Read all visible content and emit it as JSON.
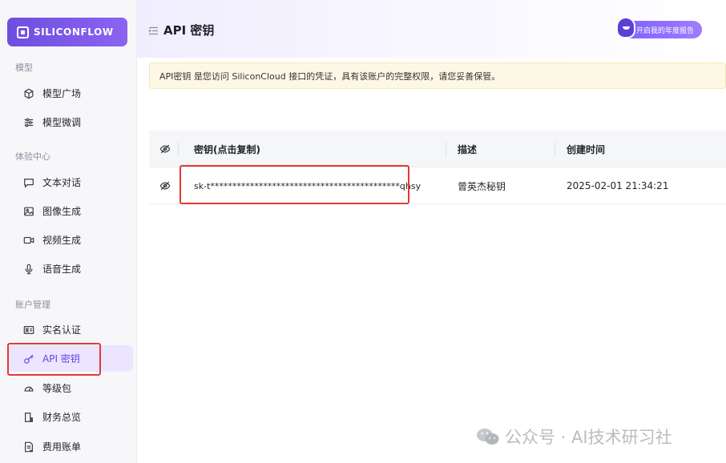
{
  "app": {
    "logo_text": "SILICONFLOW"
  },
  "sidebar": {
    "sections": [
      {
        "label": "模型",
        "items": [
          {
            "label": "模型广场",
            "icon": "cube-icon"
          },
          {
            "label": "模型微调",
            "icon": "sliders-icon"
          }
        ]
      },
      {
        "label": "体验中心",
        "items": [
          {
            "label": "文本对话",
            "icon": "chat-bubble-icon"
          },
          {
            "label": "图像生成",
            "icon": "image-icon"
          },
          {
            "label": "视频生成",
            "icon": "video-icon"
          },
          {
            "label": "语音生成",
            "icon": "microphone-icon"
          }
        ]
      },
      {
        "label": "账户管理",
        "items": [
          {
            "label": "实名认证",
            "icon": "id-card-icon"
          },
          {
            "label": "API 密钥",
            "icon": "key-icon",
            "active": true
          },
          {
            "label": "等级包",
            "icon": "gauge-icon"
          },
          {
            "label": "财务总览",
            "icon": "finance-doc-icon"
          },
          {
            "label": "费用账单",
            "icon": "bill-icon"
          }
        ]
      }
    ]
  },
  "header": {
    "title": "API 密钥",
    "report_button": "开启我的年度报告"
  },
  "notice": {
    "text": "API密钥 是您访问 SiliconCloud 接口的凭证，具有该账户的完整权限，请您妥善保管。"
  },
  "table": {
    "columns": {
      "key": "密钥(点击复制)",
      "description": "描述",
      "created": "创建时间"
    },
    "rows": [
      {
        "key": "sk-t*******************************************qhsy",
        "description": "曾英杰秘钥",
        "created": "2025-02-01 21:34:21"
      }
    ]
  },
  "watermark": {
    "text": "公众号 · AI技术研习社"
  },
  "colors": {
    "accent": "#6841ea",
    "highlight": "#e53935",
    "notice_bg": "#fdf8e6"
  }
}
